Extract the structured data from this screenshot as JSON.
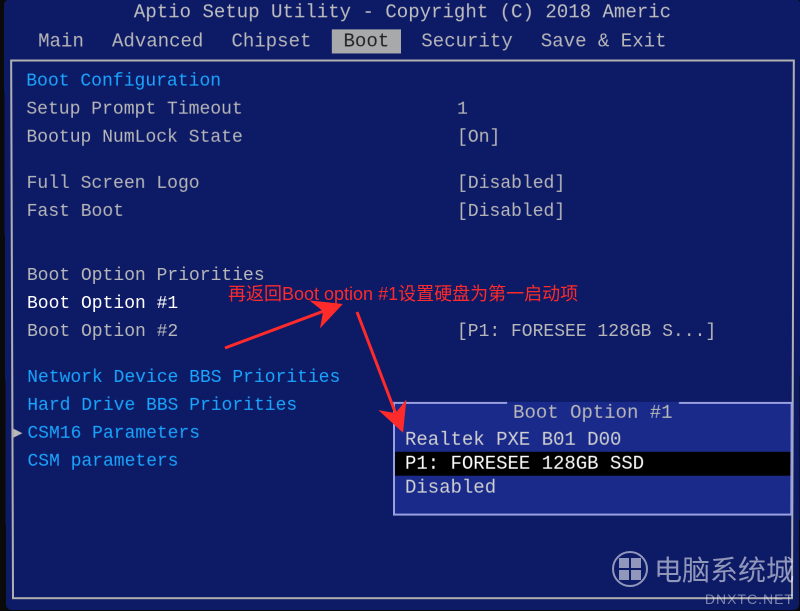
{
  "title": "Aptio Setup Utility - Copyright (C) 2018 Americ",
  "menu": {
    "items": [
      "Main",
      "Advanced",
      "Chipset",
      "Boot",
      "Security",
      "Save & Exit"
    ],
    "active_index": 3
  },
  "boot": {
    "section_title": "Boot Configuration",
    "rows": [
      {
        "label": "Setup Prompt Timeout",
        "value": "1"
      },
      {
        "label": "Bootup NumLock State",
        "value": "[On]"
      }
    ],
    "rows2": [
      {
        "label": "Full Screen Logo",
        "value": "[Disabled]"
      },
      {
        "label": "Fast Boot",
        "value": "[Disabled]"
      }
    ],
    "priorities_title": "Boot Option Priorities",
    "option1": {
      "label": "Boot Option #1",
      "value": ""
    },
    "option2": {
      "label": "Boot Option #2",
      "value": "[P1: FORESEE 128GB S...]"
    },
    "sublinks": [
      "Network Device BBS Priorities",
      "Hard Drive BBS Priorities",
      "CSM16 Parameters",
      "CSM parameters"
    ]
  },
  "popup": {
    "title": "Boot Option #1",
    "items": [
      "Realtek PXE B01 D00",
      "P1: FORESEE 128GB SSD",
      "Disabled"
    ],
    "selected_index": 1
  },
  "annotation": {
    "text": "再返回Boot option #1设置硬盘为第一启动项"
  },
  "watermark": {
    "main": "电脑系统城",
    "sub": "DNXTC.NET"
  }
}
